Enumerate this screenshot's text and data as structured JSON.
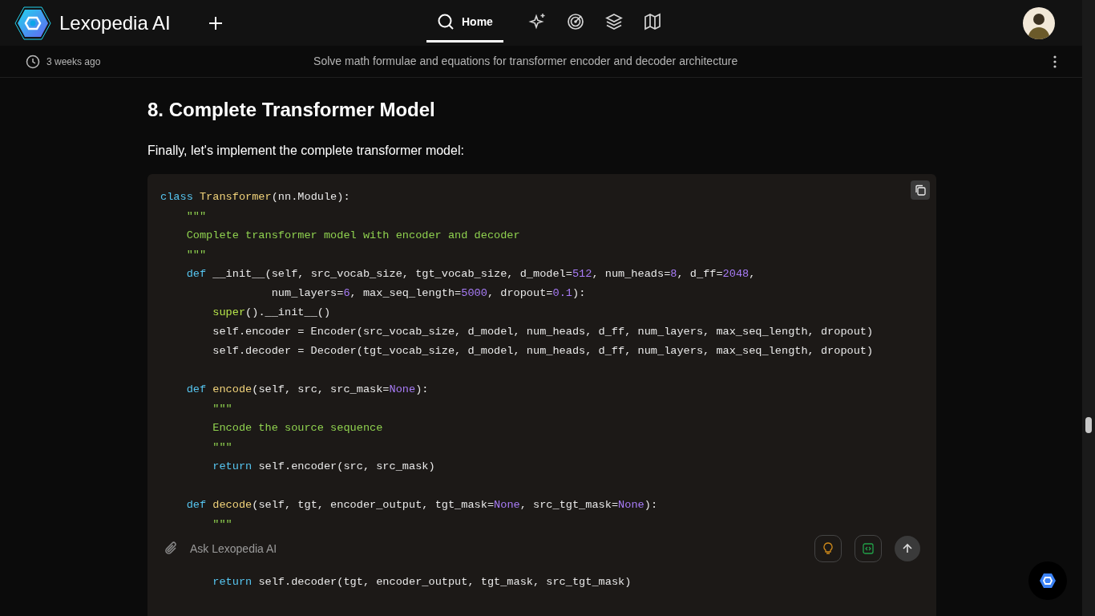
{
  "app": {
    "name": "Lexopedia AI"
  },
  "nav_tabs": [
    {
      "kind": "search",
      "label": "Home",
      "selected": true
    },
    {
      "kind": "sparkle",
      "selected": false
    },
    {
      "kind": "radar",
      "selected": false
    },
    {
      "kind": "layers",
      "selected": false
    },
    {
      "kind": "map",
      "selected": false
    }
  ],
  "thread": {
    "time": "3 weeks ago",
    "title": "Solve math formulae and equations for transformer encoder and decoder architecture"
  },
  "article": {
    "heading": "8. Complete Transformer Model",
    "intro": "Finally, let's implement the complete transformer model:"
  },
  "code_lines": [
    {
      "kind": "code",
      "tokens": [
        {
          "kind": "keyword",
          "text": "class "
        },
        {
          "kind": "name",
          "text": "Transformer"
        },
        {
          "kind": "plain",
          "text": "(nn.Module):"
        }
      ]
    },
    {
      "kind": "code",
      "tokens": [
        {
          "kind": "string",
          "text": "    \"\"\""
        }
      ]
    },
    {
      "kind": "code",
      "tokens": [
        {
          "kind": "string",
          "text": "    Complete transformer model with encoder and decoder"
        }
      ]
    },
    {
      "kind": "code",
      "tokens": [
        {
          "kind": "string",
          "text": "    \"\"\""
        }
      ]
    },
    {
      "kind": "code",
      "tokens": [
        {
          "kind": "keyword",
          "text": "    def"
        },
        {
          "kind": "plain",
          "text": " __init__(self, src_vocab_size, tgt_vocab_size, d_model="
        },
        {
          "kind": "number",
          "text": "512"
        },
        {
          "kind": "plain",
          "text": ", num_heads="
        },
        {
          "kind": "number",
          "text": "8"
        },
        {
          "kind": "plain",
          "text": ", d_ff="
        },
        {
          "kind": "number",
          "text": "2048"
        },
        {
          "kind": "plain",
          "text": ","
        }
      ]
    },
    {
      "kind": "code",
      "tokens": [
        {
          "kind": "plain",
          "text": "                 num_layers="
        },
        {
          "kind": "number",
          "text": "6"
        },
        {
          "kind": "plain",
          "text": ", max_seq_length="
        },
        {
          "kind": "number",
          "text": "5000"
        },
        {
          "kind": "plain",
          "text": ", dropout="
        },
        {
          "kind": "number",
          "text": "0.1"
        },
        {
          "kind": "plain",
          "text": "):"
        }
      ]
    },
    {
      "kind": "code",
      "tokens": [
        {
          "kind": "builtin",
          "text": "        super"
        },
        {
          "kind": "plain",
          "text": "().__init__()"
        }
      ]
    },
    {
      "kind": "code",
      "tokens": [
        {
          "kind": "plain",
          "text": "        self.encoder = Encoder(src_vocab_size, d_model, num_heads, d_ff, num_layers, max_seq_length, dropout)"
        }
      ]
    },
    {
      "kind": "code",
      "tokens": [
        {
          "kind": "plain",
          "text": "        self.decoder = Decoder(tgt_vocab_size, d_model, num_heads, d_ff, num_layers, max_seq_length, dropout)"
        }
      ]
    },
    {
      "kind": "blank"
    },
    {
      "kind": "code",
      "tokens": [
        {
          "kind": "keyword",
          "text": "    def "
        },
        {
          "kind": "name",
          "text": "encode"
        },
        {
          "kind": "plain",
          "text": "(self, src, src_mask="
        },
        {
          "kind": "number",
          "text": "None"
        },
        {
          "kind": "plain",
          "text": "):"
        }
      ]
    },
    {
      "kind": "code",
      "tokens": [
        {
          "kind": "string",
          "text": "        \"\"\""
        }
      ]
    },
    {
      "kind": "code",
      "tokens": [
        {
          "kind": "string",
          "text": "        Encode the source sequence"
        }
      ]
    },
    {
      "kind": "code",
      "tokens": [
        {
          "kind": "string",
          "text": "        \"\"\""
        }
      ]
    },
    {
      "kind": "code",
      "tokens": [
        {
          "kind": "keyword",
          "text": "        return"
        },
        {
          "kind": "plain",
          "text": " self.encoder(src, src_mask)"
        }
      ]
    },
    {
      "kind": "blank"
    },
    {
      "kind": "code",
      "tokens": [
        {
          "kind": "keyword",
          "text": "    def "
        },
        {
          "kind": "name",
          "text": "decode"
        },
        {
          "kind": "plain",
          "text": "(self, tgt, encoder_output, tgt_mask="
        },
        {
          "kind": "number",
          "text": "None"
        },
        {
          "kind": "plain",
          "text": ", src_tgt_mask="
        },
        {
          "kind": "number",
          "text": "None"
        },
        {
          "kind": "plain",
          "text": "):"
        }
      ]
    },
    {
      "kind": "code",
      "tokens": [
        {
          "kind": "string",
          "text": "        \"\"\""
        }
      ]
    },
    {
      "kind": "blank"
    },
    {
      "kind": "blank"
    },
    {
      "kind": "code",
      "tokens": [
        {
          "kind": "keyword",
          "text": "        return"
        },
        {
          "kind": "plain",
          "text": " self.decoder(tgt, encoder_output, tgt_mask, src_tgt_mask)"
        }
      ]
    }
  ],
  "composer": {
    "placeholder": "Ask Lexopedia AI"
  }
}
